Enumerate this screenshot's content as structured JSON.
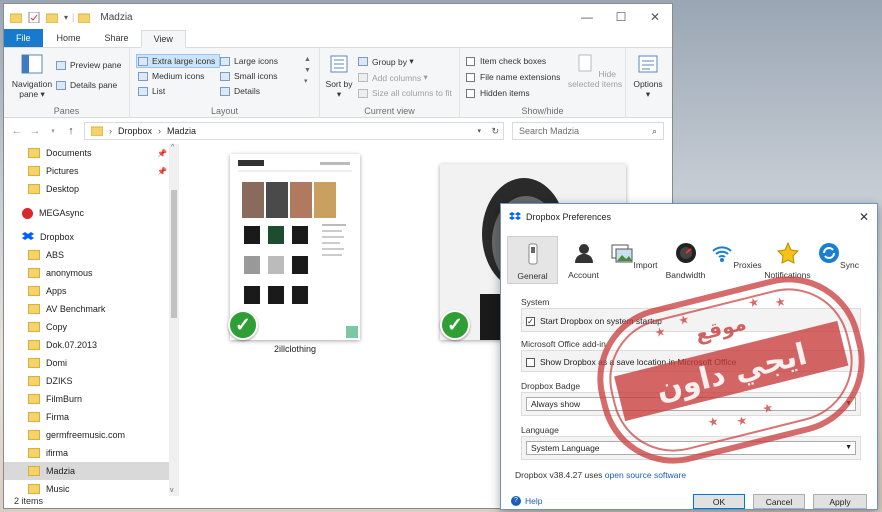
{
  "window": {
    "title": "Madzia",
    "controls": [
      "—",
      "☐",
      "✕"
    ]
  },
  "tabs": [
    "File",
    "Home",
    "Share",
    "View"
  ],
  "ribbon": {
    "panes": {
      "navigation": "Navigation pane",
      "preview": "Preview pane",
      "details": "Details pane",
      "label": "Panes"
    },
    "layout": {
      "items": [
        "Extra large icons",
        "Large icons",
        "Medium icons",
        "Small icons",
        "List",
        "Details"
      ],
      "label": "Layout"
    },
    "current_view": {
      "sort": "Sort by",
      "group": "Group by",
      "add_columns": "Add columns",
      "size_all": "Size all columns to fit",
      "label": "Current view"
    },
    "showhide": {
      "item_check": "Item check boxes",
      "ext": "File name extensions",
      "hidden": "Hidden items",
      "hide_selected": "Hide selected items",
      "label": "Show/hide"
    },
    "options": "Options"
  },
  "address": {
    "path": [
      "Dropbox",
      "Madzia"
    ],
    "search_placeholder": "Search Madzia"
  },
  "nav": [
    {
      "label": "Documents",
      "pin": true
    },
    {
      "label": "Pictures",
      "pin": true
    },
    {
      "label": "Desktop"
    },
    {
      "label": "MEGAsync"
    },
    {
      "label": "Dropbox"
    },
    {
      "label": "ABS"
    },
    {
      "label": "anonymous"
    },
    {
      "label": "Apps"
    },
    {
      "label": "AV Benchmark"
    },
    {
      "label": "Copy"
    },
    {
      "label": "Dok.07.2013"
    },
    {
      "label": "Domi"
    },
    {
      "label": "DZIKS"
    },
    {
      "label": "FilmBurn"
    },
    {
      "label": "Firma"
    },
    {
      "label": "germfreemusic.com"
    },
    {
      "label": "ifirma"
    },
    {
      "label": "Madzia"
    },
    {
      "label": "Music"
    }
  ],
  "files": [
    {
      "name": "2illclothing"
    }
  ],
  "status": "2 items",
  "dialog": {
    "title": "Dropbox Preferences",
    "tabs": [
      "General",
      "Account",
      "Import",
      "Bandwidth",
      "Proxies",
      "Notifications",
      "Sync"
    ],
    "system": {
      "label": "System",
      "start": "Start Dropbox on system startup",
      "checked": true
    },
    "office": {
      "label": "Microsoft Office add-in",
      "show": "Show Dropbox as a save location in Microsoft Office",
      "checked": false
    },
    "badge": {
      "label": "Dropbox Badge",
      "value": "Always show"
    },
    "language": {
      "label": "Language",
      "value": "System Language"
    },
    "version": "Dropbox v38.4.27 uses",
    "oss": "open source software",
    "help": "Help",
    "ok": "OK",
    "cancel": "Cancel",
    "apply": "Apply"
  },
  "watermark": {
    "line1": "موقع",
    "line2": "ايجي داون"
  }
}
